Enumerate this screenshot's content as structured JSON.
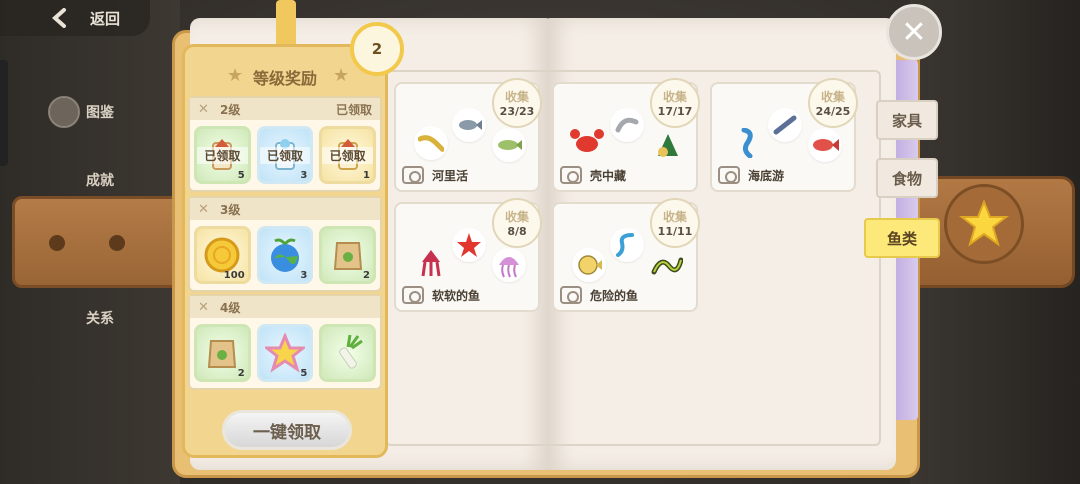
{
  "nav": {
    "back_label": "返回",
    "menu": [
      "图鉴",
      "成就",
      "关系"
    ]
  },
  "reward_panel": {
    "title": "等级奖励",
    "level": "2",
    "tiers": [
      {
        "level_label": "2级",
        "status": "已领取",
        "items": [
          {
            "icon": "scroll-tag-icon",
            "count": "5",
            "claimed": "已领取",
            "bg": "green"
          },
          {
            "icon": "bubble-tag-icon",
            "count": "3",
            "claimed": "已领取",
            "bg": "blue"
          },
          {
            "icon": "star-tag-icon",
            "count": "1",
            "claimed": "已领取",
            "bg": "yellow"
          }
        ]
      },
      {
        "level_label": "3级",
        "status": "",
        "items": [
          {
            "icon": "gold-coin-icon",
            "count": "100",
            "bg": "yellow"
          },
          {
            "icon": "globe-sprout-icon",
            "count": "3",
            "bg": "blue"
          },
          {
            "icon": "seed-bag-icon",
            "count": "2",
            "bg": "green"
          }
        ]
      },
      {
        "level_label": "4级",
        "status": "",
        "items": [
          {
            "icon": "seed-bag-icon",
            "count": "2",
            "bg": "green"
          },
          {
            "icon": "rainbow-star-icon",
            "count": "5",
            "bg": "blue"
          },
          {
            "icon": "leek-icon",
            "count": "",
            "bg": "green"
          }
        ]
      }
    ],
    "claim_all_label": "一键领取"
  },
  "collections": [
    {
      "name": "河里活",
      "collect_label": "收集",
      "count": "23/23",
      "icons": [
        "eel-icon",
        "fish-icon",
        "trout-icon"
      ]
    },
    {
      "name": "壳中藏",
      "collect_label": "收集",
      "count": "17/17",
      "icons": [
        "crab-icon",
        "shrimp-icon",
        "snail-icon"
      ]
    },
    {
      "name": "海底游",
      "collect_label": "收集",
      "count": "24/25",
      "icons": [
        "seahorse-icon",
        "sardine-icon",
        "red-fish-icon"
      ]
    },
    {
      "name": "软软的鱼",
      "collect_label": "收集",
      "count": "8/8",
      "icons": [
        "squid-icon",
        "starfish-icon",
        "jellyfish-icon"
      ]
    },
    {
      "name": "危险的鱼",
      "collect_label": "收集",
      "count": "11/11",
      "icons": [
        "pufferfish-icon",
        "snake-icon",
        "moray-icon"
      ]
    }
  ],
  "categories": [
    {
      "label": "家具",
      "active": false
    },
    {
      "label": "食物",
      "active": false
    },
    {
      "label": "鱼类",
      "active": true
    }
  ],
  "colors": {
    "panel_gold": "#f2d690",
    "active_tab": "#fde97a",
    "page": "#f4eee6"
  }
}
